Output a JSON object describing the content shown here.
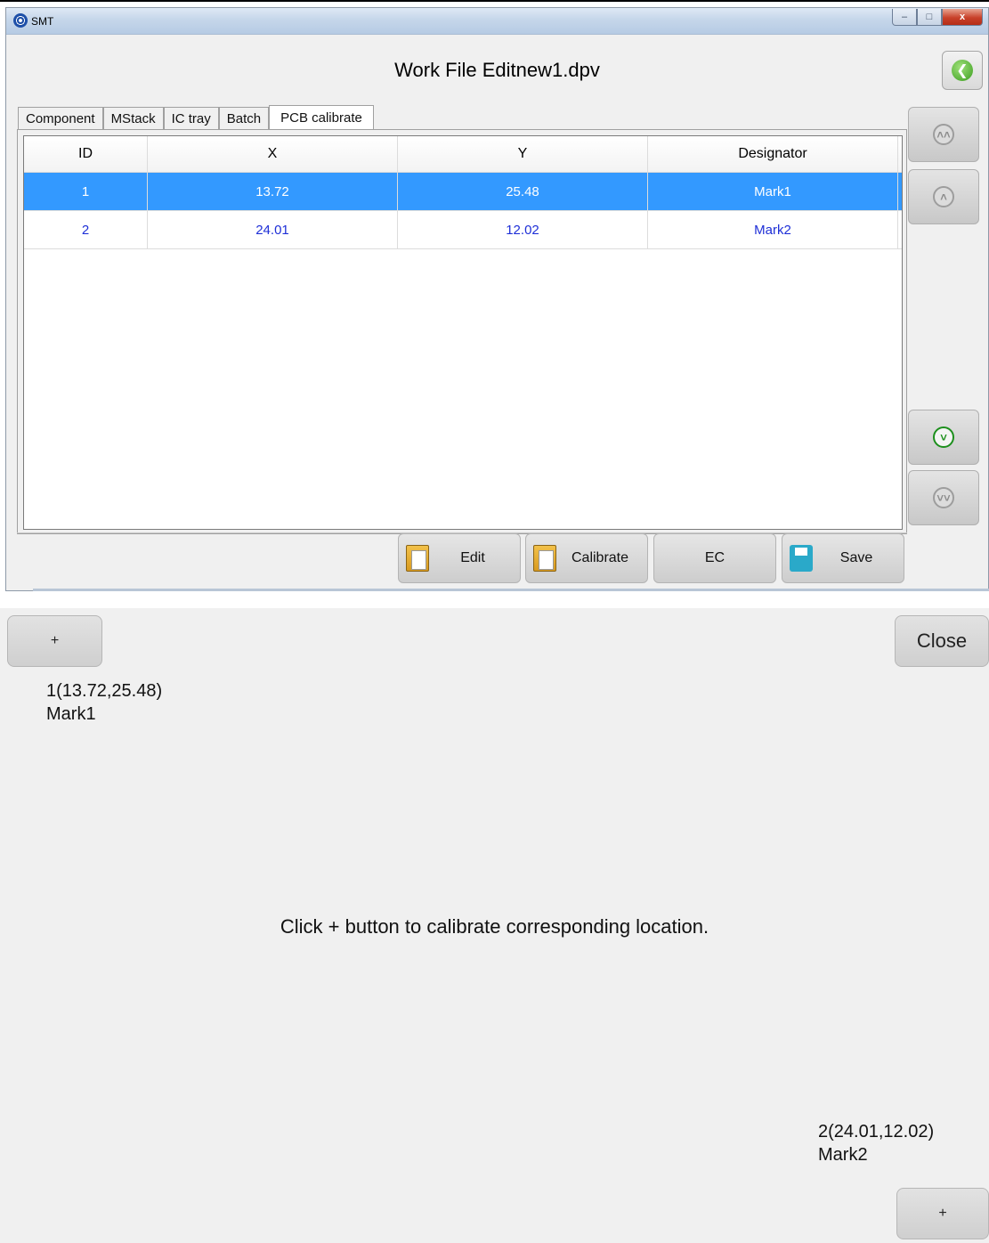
{
  "app": {
    "name": "SMT"
  },
  "window": {
    "title": "Work File Editnew1.dpv",
    "controls": {
      "minimize": "–",
      "maximize": "□",
      "close": "x"
    }
  },
  "tabs": [
    {
      "label": "Component",
      "active": false
    },
    {
      "label": "MStack",
      "active": false
    },
    {
      "label": "IC tray",
      "active": false
    },
    {
      "label": "Batch",
      "active": false
    },
    {
      "label": "PCB calibrate",
      "active": true
    }
  ],
  "table": {
    "columns": [
      "ID",
      "X",
      "Y",
      "Designator"
    ],
    "rows": [
      {
        "id": "1",
        "x": "13.72",
        "y": "25.48",
        "designator": "Mark1",
        "selected": true
      },
      {
        "id": "2",
        "x": "24.01",
        "y": "12.02",
        "designator": "Mark2",
        "selected": false
      }
    ]
  },
  "actions": {
    "edit": "Edit",
    "calibrate": "Calibrate",
    "ec": "EC",
    "save": "Save"
  },
  "side_nav": {
    "top": "top-icon",
    "up": "up-icon",
    "down": "down-icon",
    "bottom": "bottom-icon"
  },
  "calibration": {
    "plus_label": "+",
    "close_label": "Close",
    "point1": {
      "coords": "1(13.72,25.48)",
      "name": "Mark1"
    },
    "point2": {
      "coords": "2(24.01,12.02)",
      "name": "Mark2"
    },
    "instruction": "Click + button to calibrate corresponding location."
  },
  "colors": {
    "selected_row": "#3399ff",
    "row_text": "#1e2fd7",
    "back_button": "#3a9d1e"
  }
}
